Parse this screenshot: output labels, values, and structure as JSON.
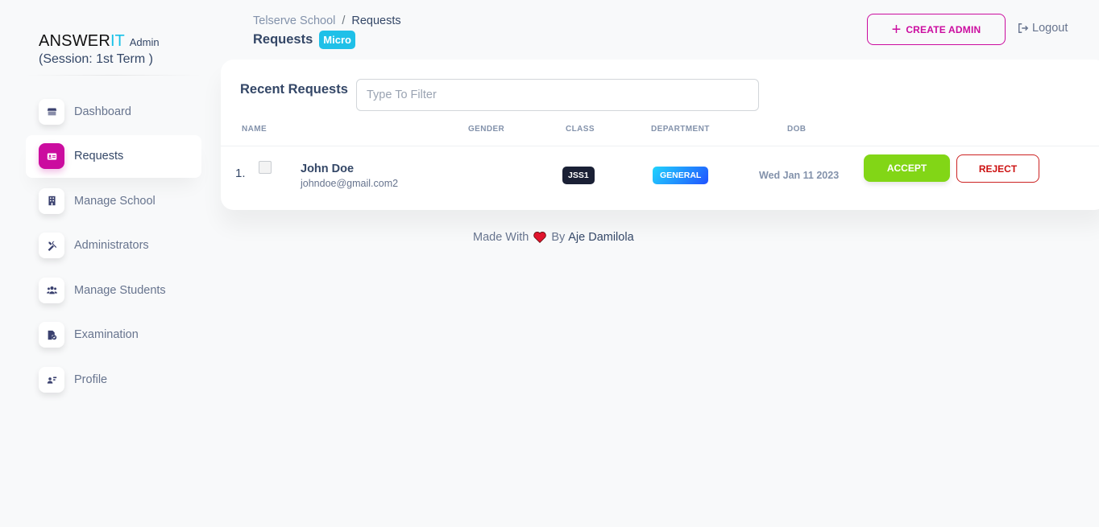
{
  "brand": {
    "answer": "ANSWER",
    "it": "IT",
    "admin": "Admin",
    "session": "(Session: 1st Term )"
  },
  "sidebar": {
    "items": [
      {
        "label": "Dashboard",
        "icon": "shop-icon"
      },
      {
        "label": "Requests",
        "icon": "id-card-icon",
        "active": true
      },
      {
        "label": "Manage School",
        "icon": "building-icon"
      },
      {
        "label": "Administrators",
        "icon": "tools-icon"
      },
      {
        "label": "Manage Students",
        "icon": "users-icon"
      },
      {
        "label": "Examination",
        "icon": "file-check-icon"
      },
      {
        "label": "Profile",
        "icon": "user-card-icon"
      }
    ]
  },
  "header": {
    "breadcrumb_parent": "Telserve School",
    "breadcrumb_separator": "/",
    "breadcrumb_current": "Requests",
    "title": "Requests",
    "badge": "Micro",
    "create_admin_label": "CREATE ADMIN",
    "logout_label": "Logout"
  },
  "card": {
    "title": "Recent Requests",
    "filter_placeholder": "Type To Filter",
    "filter_value": "",
    "columns": [
      "NAME",
      "GENDER",
      "CLASS",
      "DEPARTMENT",
      "DOB"
    ],
    "rows": [
      {
        "index": "1.",
        "name": "John Doe",
        "email": "johndoe@gmail.com2",
        "gender": "",
        "class": "JSS1",
        "department": "GENERAL",
        "dob": "Wed Jan 11 2023",
        "accept_label": "ACCEPT",
        "reject_label": "REJECT"
      }
    ]
  },
  "footer": {
    "made_with": "Made With",
    "by": "By",
    "author": "Aje Damilola"
  },
  "colors": {
    "primary": "#cb0c9f",
    "accent": "#17c1e8",
    "success": "#82d616",
    "danger": "#cc1111",
    "dark": "#1a2035"
  }
}
